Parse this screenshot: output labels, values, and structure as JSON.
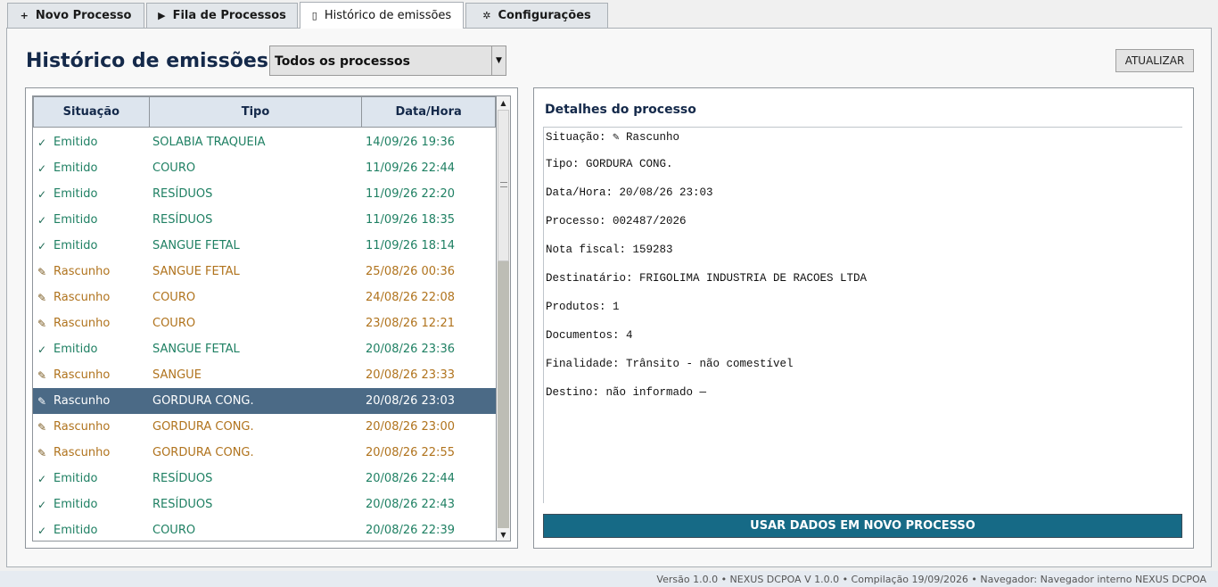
{
  "tabs": [
    {
      "icon": "+",
      "label": "Novo Processo"
    },
    {
      "icon": "▶",
      "label": "Fila de Processos"
    },
    {
      "icon": "▯",
      "label": "Histórico de emissões"
    },
    {
      "icon": "✲",
      "label": "Configurações"
    }
  ],
  "page": {
    "title": "Histórico de emissões",
    "filter_value": "Todos os processos",
    "refresh_label": "ATUALIZAR"
  },
  "list": {
    "headers": {
      "status": "Situação",
      "type": "Tipo",
      "datetime": "Data/Hora"
    },
    "rows": [
      {
        "mark": "✓",
        "status": "Emitido",
        "type": "SOLABIA TRAQUEIA",
        "datetime": "14/09/26 19:36"
      },
      {
        "mark": "✓",
        "status": "Emitido",
        "type": "COURO",
        "datetime": "11/09/26 22:44"
      },
      {
        "mark": "✓",
        "status": "Emitido",
        "type": "RESÍDUOS",
        "datetime": "11/09/26 22:20"
      },
      {
        "mark": "✓",
        "status": "Emitido",
        "type": "RESÍDUOS",
        "datetime": "11/09/26 18:35"
      },
      {
        "mark": "✓",
        "status": "Emitido",
        "type": "SANGUE FETAL",
        "datetime": "11/09/26 18:14"
      },
      {
        "mark": "✎",
        "status": "Rascunho",
        "type": "SANGUE FETAL",
        "datetime": "25/08/26 00:36"
      },
      {
        "mark": "✎",
        "status": "Rascunho",
        "type": "COURO",
        "datetime": "24/08/26 22:08"
      },
      {
        "mark": "✎",
        "status": "Rascunho",
        "type": "COURO",
        "datetime": "23/08/26 12:21"
      },
      {
        "mark": "✓",
        "status": "Emitido",
        "type": "SANGUE FETAL",
        "datetime": "20/08/26 23:36"
      },
      {
        "mark": "✎",
        "status": "Rascunho",
        "type": "SANGUE",
        "datetime": "20/08/26 23:33"
      },
      {
        "mark": "✎",
        "status": "Rascunho",
        "type": "GORDURA CONG.",
        "datetime": "20/08/26 23:03"
      },
      {
        "mark": "✎",
        "status": "Rascunho",
        "type": "GORDURA CONG.",
        "datetime": "20/08/26 23:00"
      },
      {
        "mark": "✎",
        "status": "Rascunho",
        "type": "GORDURA CONG.",
        "datetime": "20/08/26 22:55"
      },
      {
        "mark": "✓",
        "status": "Emitido",
        "type": "RESÍDUOS",
        "datetime": "20/08/26 22:44"
      },
      {
        "mark": "✓",
        "status": "Emitido",
        "type": "RESÍDUOS",
        "datetime": "20/08/26 22:43"
      },
      {
        "mark": "✓",
        "status": "Emitido",
        "type": "COURO",
        "datetime": "20/08/26 22:39"
      }
    ]
  },
  "details": {
    "title": "Detalhes do processo",
    "lines": [
      "Situação: ✎ Rascunho",
      "Tipo: GORDURA CONG.",
      "Data/Hora: 20/08/26 23:03",
      "Processo: 002487/2026",
      "Nota fiscal: 159283",
      "Destinatário: FRIGOLIMA INDUSTRIA DE RACOES LTDA",
      "Produtos: 1",
      "Documentos: 4",
      "Finalidade: Trânsito - não comestível",
      "Destino: não informado —"
    ],
    "use_button_label": "USAR DADOS EM NOVO PROCESSO"
  },
  "footer": {
    "text": "Versão 1.0.0 • NEXUS DCPOA V 1.0.0 • Compilação 19/09/2026 • Navegador: Navegador interno NEXUS DCPOA"
  },
  "colors": {
    "emitted": "#1f8063",
    "draft": "#b0731d",
    "selected_row": "#4b6a86",
    "primary_button": "#166a86",
    "title": "#14294a"
  }
}
